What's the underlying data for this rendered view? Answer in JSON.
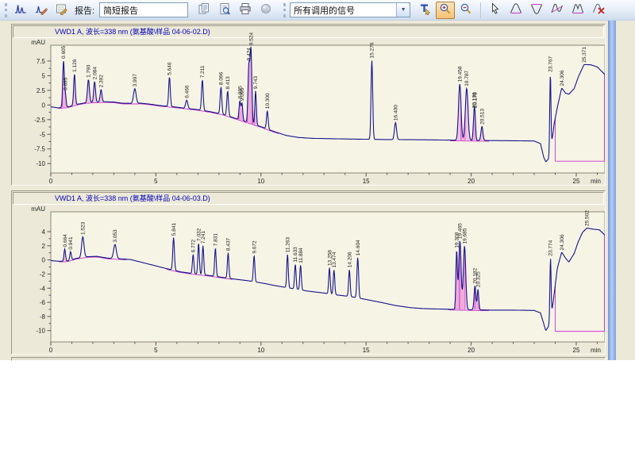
{
  "toolbar": {
    "report_label": "报告:",
    "report_combo_value": "简短报告",
    "signals_combo_value": "所有调用的信号",
    "accent_active_button_color": "#f4c276",
    "icons": {
      "left_group": [
        "integrate-icon",
        "manual-integrate-icon",
        "annotate-signal-icon"
      ],
      "report_group": [
        "copy-report-icon",
        "print-preview-icon",
        "print-icon",
        "publish-icon"
      ],
      "signal_group": [
        "pointer-text-icon",
        "zoom-in-icon",
        "zoom-out-icon",
        "select-cursor-icon",
        "peak-icon",
        "negative-peak-icon",
        "tangent-skim-icon",
        "shoulder-peak-icon",
        "delete-peak-icon"
      ],
      "active_tool": "zoom-in-icon"
    }
  },
  "chart_data": [
    {
      "type": "line",
      "title": "VWD1 A, 波长=338 nm (氨基酸\\样品 04-06-02.D)",
      "ylabel": "mAU",
      "xlabel": "min",
      "x_ticks": [
        0,
        5,
        10,
        15,
        20,
        25
      ],
      "y_ticks": [
        7.5,
        5,
        2.5,
        0,
        -2.5,
        -5,
        -7.5,
        -10
      ],
      "xlim": [
        0,
        26.36
      ],
      "ylim": [
        -11.6,
        10.2
      ],
      "grid": false,
      "line_color": "#14148c",
      "integration_color": "#cc33cc",
      "baseline": [
        [
          0,
          -0.3
        ],
        [
          0.35,
          -0.5
        ],
        [
          0.8,
          -0.35
        ],
        [
          1.3,
          0.15
        ],
        [
          1.7,
          0.4
        ],
        [
          2.1,
          0.5
        ],
        [
          2.6,
          0.55
        ],
        [
          3.0,
          0.5
        ],
        [
          3.4,
          0.3
        ],
        [
          3.8,
          0.28
        ],
        [
          4.3,
          0.3
        ],
        [
          4.7,
          0.15
        ],
        [
          5.2,
          -0.1
        ],
        [
          5.8,
          -0.3
        ],
        [
          6.4,
          -0.55
        ],
        [
          7.0,
          -0.8
        ],
        [
          7.6,
          -1.15
        ],
        [
          8.2,
          -1.6
        ],
        [
          8.8,
          -2.3
        ],
        [
          9.4,
          -3.0
        ],
        [
          10.0,
          -3.7
        ],
        [
          10.6,
          -4.5
        ],
        [
          11.2,
          -5.2
        ],
        [
          11.8,
          -5.55
        ],
        [
          12.5,
          -5.7
        ],
        [
          14,
          -5.8
        ],
        [
          16,
          -5.9
        ],
        [
          18,
          -5.95
        ],
        [
          20,
          -6.05
        ],
        [
          22,
          -6.1
        ],
        [
          23.0,
          -6.15
        ],
        [
          23.3,
          -6.6
        ],
        [
          23.45,
          -8.9
        ],
        [
          23.55,
          -9.7
        ],
        [
          23.68,
          -9.2
        ],
        [
          23.82,
          -6.8
        ],
        [
          23.95,
          -3.2
        ],
        [
          24.1,
          -0.4
        ],
        [
          24.306,
          2.9
        ],
        [
          24.5,
          2.0
        ],
        [
          24.65,
          1.85
        ],
        [
          24.9,
          2.8
        ],
        [
          25.1,
          4.8
        ],
        [
          25.371,
          6.9
        ],
        [
          25.7,
          6.85
        ],
        [
          26.0,
          6.5
        ],
        [
          26.36,
          5.2
        ]
      ],
      "mag_ranges": [
        [
          0.35,
          10.9
        ],
        [
          19.0,
          20.9
        ]
      ],
      "end_baseline": {
        "t0": 24.0,
        "t1": 26.36,
        "y": -9.6
      },
      "peaks": [
        {
          "t": 0.605,
          "h": 7.9,
          "w": 0.055,
          "label": "0.605",
          "fill": true
        },
        {
          "t": 0.695,
          "h": 2.0,
          "w": 0.05,
          "label": "0.695",
          "fill": true
        },
        {
          "t": 1.126,
          "h": 5.3,
          "w": 0.055,
          "label": "1.126",
          "fill": true
        },
        {
          "t": 1.79,
          "h": 3.9,
          "w": 0.065,
          "label": "1.790",
          "fill": true
        },
        {
          "t": 2.084,
          "h": 3.5,
          "w": 0.06,
          "label": "2.084",
          "fill": true
        },
        {
          "t": 2.392,
          "h": 2.1,
          "w": 0.06,
          "label": "2.392",
          "fill": true
        },
        {
          "t": 3.997,
          "h": 2.5,
          "w": 0.085,
          "label": "3.997",
          "fill": false
        },
        {
          "t": 5.646,
          "h": 5.0,
          "w": 0.055,
          "label": "5.646",
          "fill": false
        },
        {
          "t": 6.466,
          "h": 1.4,
          "w": 0.07,
          "label": "6.466",
          "fill": false
        },
        {
          "t": 7.211,
          "h": 5.2,
          "w": 0.055,
          "label": "7.211",
          "fill": false
        },
        {
          "t": 8.096,
          "h": 4.6,
          "w": 0.055,
          "label": "8.096",
          "fill": false
        },
        {
          "t": 8.413,
          "h": 4.2,
          "w": 0.055,
          "label": "8.413",
          "fill": false
        },
        {
          "t": 8.995,
          "h": 3.2,
          "w": 0.055,
          "label": "8.995",
          "fill": true
        },
        {
          "t": 9.096,
          "h": 2.9,
          "w": 0.05,
          "label": "9.096",
          "fill": true
        },
        {
          "t": 9.424,
          "h": 9.5,
          "w": 0.06,
          "label": "9.424",
          "fill": true
        },
        {
          "t": 9.524,
          "h": 12.4,
          "w": 0.06,
          "label": "9.524",
          "fill": true
        },
        {
          "t": 9.743,
          "h": 5.8,
          "w": 0.05,
          "label": "9.743",
          "fill": true
        },
        {
          "t": 10.3,
          "h": 3.1,
          "w": 0.055,
          "label": "10.300",
          "fill": false
        },
        {
          "t": 15.276,
          "h": 13.5,
          "w": 0.055,
          "label": "15.276",
          "fill": false
        },
        {
          "t": 16.4,
          "h": 2.9,
          "w": 0.07,
          "label": "16.400",
          "fill": false
        },
        {
          "t": 19.458,
          "h": 9.6,
          "w": 0.085,
          "label": "19.458",
          "fill": true
        },
        {
          "t": 19.787,
          "h": 8.9,
          "w": 0.09,
          "label": "19.787",
          "fill": true
        },
        {
          "t": 20.136,
          "h": 3.6,
          "w": 0.055,
          "label": "20.136",
          "fill": true
        },
        {
          "t": 20.178,
          "h": 3.2,
          "w": 0.05,
          "label": "20.178",
          "fill": true
        },
        {
          "t": 20.513,
          "h": 2.4,
          "w": 0.065,
          "label": "20.513",
          "fill": true
        },
        {
          "t": 23.767,
          "h": 13.0,
          "w": 0.04,
          "label": "23.767",
          "fill": false
        },
        {
          "t": 24.306,
          "h": 0,
          "w": 0.01,
          "label": "24.306",
          "fill": false
        },
        {
          "t": 25.371,
          "h": 0,
          "w": 0.01,
          "label": "25.371",
          "fill": false
        }
      ]
    },
    {
      "type": "line",
      "title": "VWD1 A, 波长=338 nm (氨基酸\\样品 04-06-03.D)",
      "ylabel": "mAU",
      "xlabel": "min",
      "x_ticks": [
        0,
        5,
        10,
        15,
        20,
        25
      ],
      "y_ticks": [
        4,
        2,
        0,
        -2,
        -4,
        -6,
        -8,
        -10
      ],
      "xlim": [
        0,
        26.36
      ],
      "ylim": [
        -11.6,
        6.8
      ],
      "grid": false,
      "line_color": "#14148c",
      "integration_color": "#cc33cc",
      "baseline": [
        [
          0,
          -0.1
        ],
        [
          0.4,
          -0.2
        ],
        [
          0.8,
          -0.15
        ],
        [
          1.2,
          0.2
        ],
        [
          1.7,
          0.45
        ],
        [
          2.2,
          0.5
        ],
        [
          2.7,
          0.25
        ],
        [
          3.3,
          0.15
        ],
        [
          3.8,
          0.05
        ],
        [
          4.4,
          -0.4
        ],
        [
          5.0,
          -0.85
        ],
        [
          5.6,
          -1.3
        ],
        [
          6.2,
          -1.7
        ],
        [
          6.8,
          -1.95
        ],
        [
          7.4,
          -2.15
        ],
        [
          8.0,
          -2.4
        ],
        [
          8.7,
          -2.7
        ],
        [
          9.4,
          -2.95
        ],
        [
          10.1,
          -3.3
        ],
        [
          10.8,
          -3.7
        ],
        [
          11.5,
          -4.05
        ],
        [
          12.2,
          -4.4
        ],
        [
          12.9,
          -4.65
        ],
        [
          13.6,
          -4.95
        ],
        [
          14.3,
          -5.2
        ],
        [
          15.0,
          -5.6
        ],
        [
          15.7,
          -6.0
        ],
        [
          16.4,
          -6.45
        ],
        [
          17.1,
          -6.75
        ],
        [
          17.8,
          -6.9
        ],
        [
          18.5,
          -6.95
        ],
        [
          19.2,
          -7.0
        ],
        [
          20.0,
          -7.05
        ],
        [
          21,
          -7.1
        ],
        [
          22,
          -7.1
        ],
        [
          23.0,
          -7.15
        ],
        [
          23.3,
          -7.5
        ],
        [
          23.45,
          -9.0
        ],
        [
          23.55,
          -10.0
        ],
        [
          23.68,
          -9.4
        ],
        [
          23.82,
          -7.8
        ],
        [
          23.95,
          -4.8
        ],
        [
          24.1,
          -1.2
        ],
        [
          24.306,
          1.1
        ],
        [
          24.5,
          0.2
        ],
        [
          24.65,
          -0.3
        ],
        [
          24.9,
          0.9
        ],
        [
          25.1,
          2.6
        ],
        [
          25.3,
          3.9
        ],
        [
          25.502,
          4.5
        ],
        [
          25.8,
          4.35
        ],
        [
          26.1,
          4.25
        ],
        [
          26.36,
          3.5
        ]
      ],
      "mag_ranges": [
        [
          0.4,
          3.6
        ],
        [
          5.5,
          8.7
        ],
        [
          18.9,
          20.9
        ]
      ],
      "end_baseline": {
        "t0": 24.0,
        "t1": 26.36,
        "y": -10.1
      },
      "peaks": [
        {
          "t": 0.664,
          "h": 1.7,
          "w": 0.05,
          "label": "0.664",
          "fill": true
        },
        {
          "t": 0.941,
          "h": 1.2,
          "w": 0.05,
          "label": "0.941",
          "fill": false
        },
        {
          "t": 1.523,
          "h": 2.9,
          "w": 0.08,
          "label": "1.523",
          "fill": false
        },
        {
          "t": 3.053,
          "h": 2.0,
          "w": 0.09,
          "label": "3.053",
          "fill": false
        },
        {
          "t": 5.841,
          "h": 4.6,
          "w": 0.055,
          "label": "5.841",
          "fill": false
        },
        {
          "t": 6.772,
          "h": 2.7,
          "w": 0.05,
          "label": "6.772",
          "fill": false
        },
        {
          "t": 7.032,
          "h": 4.4,
          "w": 0.05,
          "label": "7.032",
          "fill": false
        },
        {
          "t": 7.241,
          "h": 4.1,
          "w": 0.05,
          "label": "7.241",
          "fill": false
        },
        {
          "t": 7.831,
          "h": 4.0,
          "w": 0.05,
          "label": "7.831",
          "fill": false
        },
        {
          "t": 8.437,
          "h": 3.6,
          "w": 0.05,
          "label": "8.437",
          "fill": false
        },
        {
          "t": 9.672,
          "h": 3.7,
          "w": 0.05,
          "label": "9.672",
          "fill": false
        },
        {
          "t": 11.263,
          "h": 4.7,
          "w": 0.05,
          "label": "11.263",
          "fill": false
        },
        {
          "t": 11.633,
          "h": 3.5,
          "w": 0.05,
          "label": "11.633",
          "fill": false
        },
        {
          "t": 11.884,
          "h": 3.5,
          "w": 0.05,
          "label": "11.884",
          "fill": false
        },
        {
          "t": 13.258,
          "h": 3.7,
          "w": 0.05,
          "label": "13.258",
          "fill": false
        },
        {
          "t": 13.474,
          "h": 3.5,
          "w": 0.05,
          "label": "13.474",
          "fill": false
        },
        {
          "t": 14.206,
          "h": 3.8,
          "w": 0.05,
          "label": "14.206",
          "fill": false
        },
        {
          "t": 14.604,
          "h": 5.7,
          "w": 0.055,
          "label": "14.604",
          "fill": false
        },
        {
          "t": 19.308,
          "h": 8.2,
          "w": 0.05,
          "label": "19.308",
          "fill": true
        },
        {
          "t": 19.465,
          "h": 9.7,
          "w": 0.08,
          "label": "19.465",
          "fill": true
        },
        {
          "t": 19.685,
          "h": 9.0,
          "w": 0.08,
          "label": "19.685",
          "fill": true
        },
        {
          "t": 20.182,
          "h": 3.4,
          "w": 0.06,
          "label": "20.182",
          "fill": true
        },
        {
          "t": 20.325,
          "h": 2.9,
          "w": 0.05,
          "label": "20.325",
          "fill": true
        },
        {
          "t": 23.774,
          "h": 8.6,
          "w": 0.04,
          "label": "23.774",
          "fill": false
        },
        {
          "t": 24.306,
          "h": 0,
          "w": 0.01,
          "label": "24.306",
          "fill": false
        },
        {
          "t": 25.502,
          "h": 0,
          "w": 0.01,
          "label": "25.502",
          "fill": false
        }
      ]
    }
  ]
}
